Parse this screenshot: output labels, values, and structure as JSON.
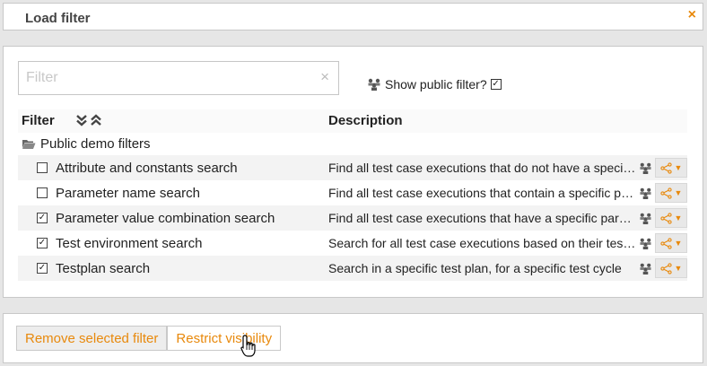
{
  "dialog": {
    "title": "Load filter",
    "close_glyph": "×"
  },
  "filter": {
    "placeholder": "Filter",
    "value": "",
    "clear_glyph": "×"
  },
  "public_toggle": {
    "label": "Show public filter?",
    "checked": true,
    "checkmark": "✓"
  },
  "table": {
    "col_filter": "Filter",
    "col_description": "Description",
    "group": {
      "name": "Public demo filters"
    },
    "rows": [
      {
        "name": "Attribute and constants search",
        "description": "Find all test case executions that do not have a specific attribute",
        "checked": false,
        "mark": ""
      },
      {
        "name": "Parameter name search",
        "description": "Find all test case executions that contain a specific parameter",
        "checked": false,
        "mark": ""
      },
      {
        "name": "Parameter value combination search",
        "description": "Find all test case executions that have a specific parameter value combination",
        "checked": true,
        "mark": "✓"
      },
      {
        "name": "Test environment search",
        "description": "Search for all test case executions based on their test environment",
        "checked": true,
        "mark": "✓"
      },
      {
        "name": "Testplan search",
        "description": "Search in a specific test plan, for a specific test cycle",
        "checked": true,
        "mark": "✓"
      }
    ]
  },
  "footer": {
    "remove_label": "Remove selected filter",
    "restrict_label": "Restrict visibility"
  },
  "colors": {
    "accent": "#e8890c",
    "owner_icon": "#555555"
  },
  "icons": {
    "close": "close-icon",
    "clear": "clear-icon",
    "public": "people-icon",
    "sort_down": "double-chevron-down-icon",
    "sort_up": "double-chevron-up-icon",
    "folder": "folder-open-icon",
    "share": "share-icon",
    "caret": "caret-down-icon",
    "cursor": "hand-pointer-icon"
  }
}
